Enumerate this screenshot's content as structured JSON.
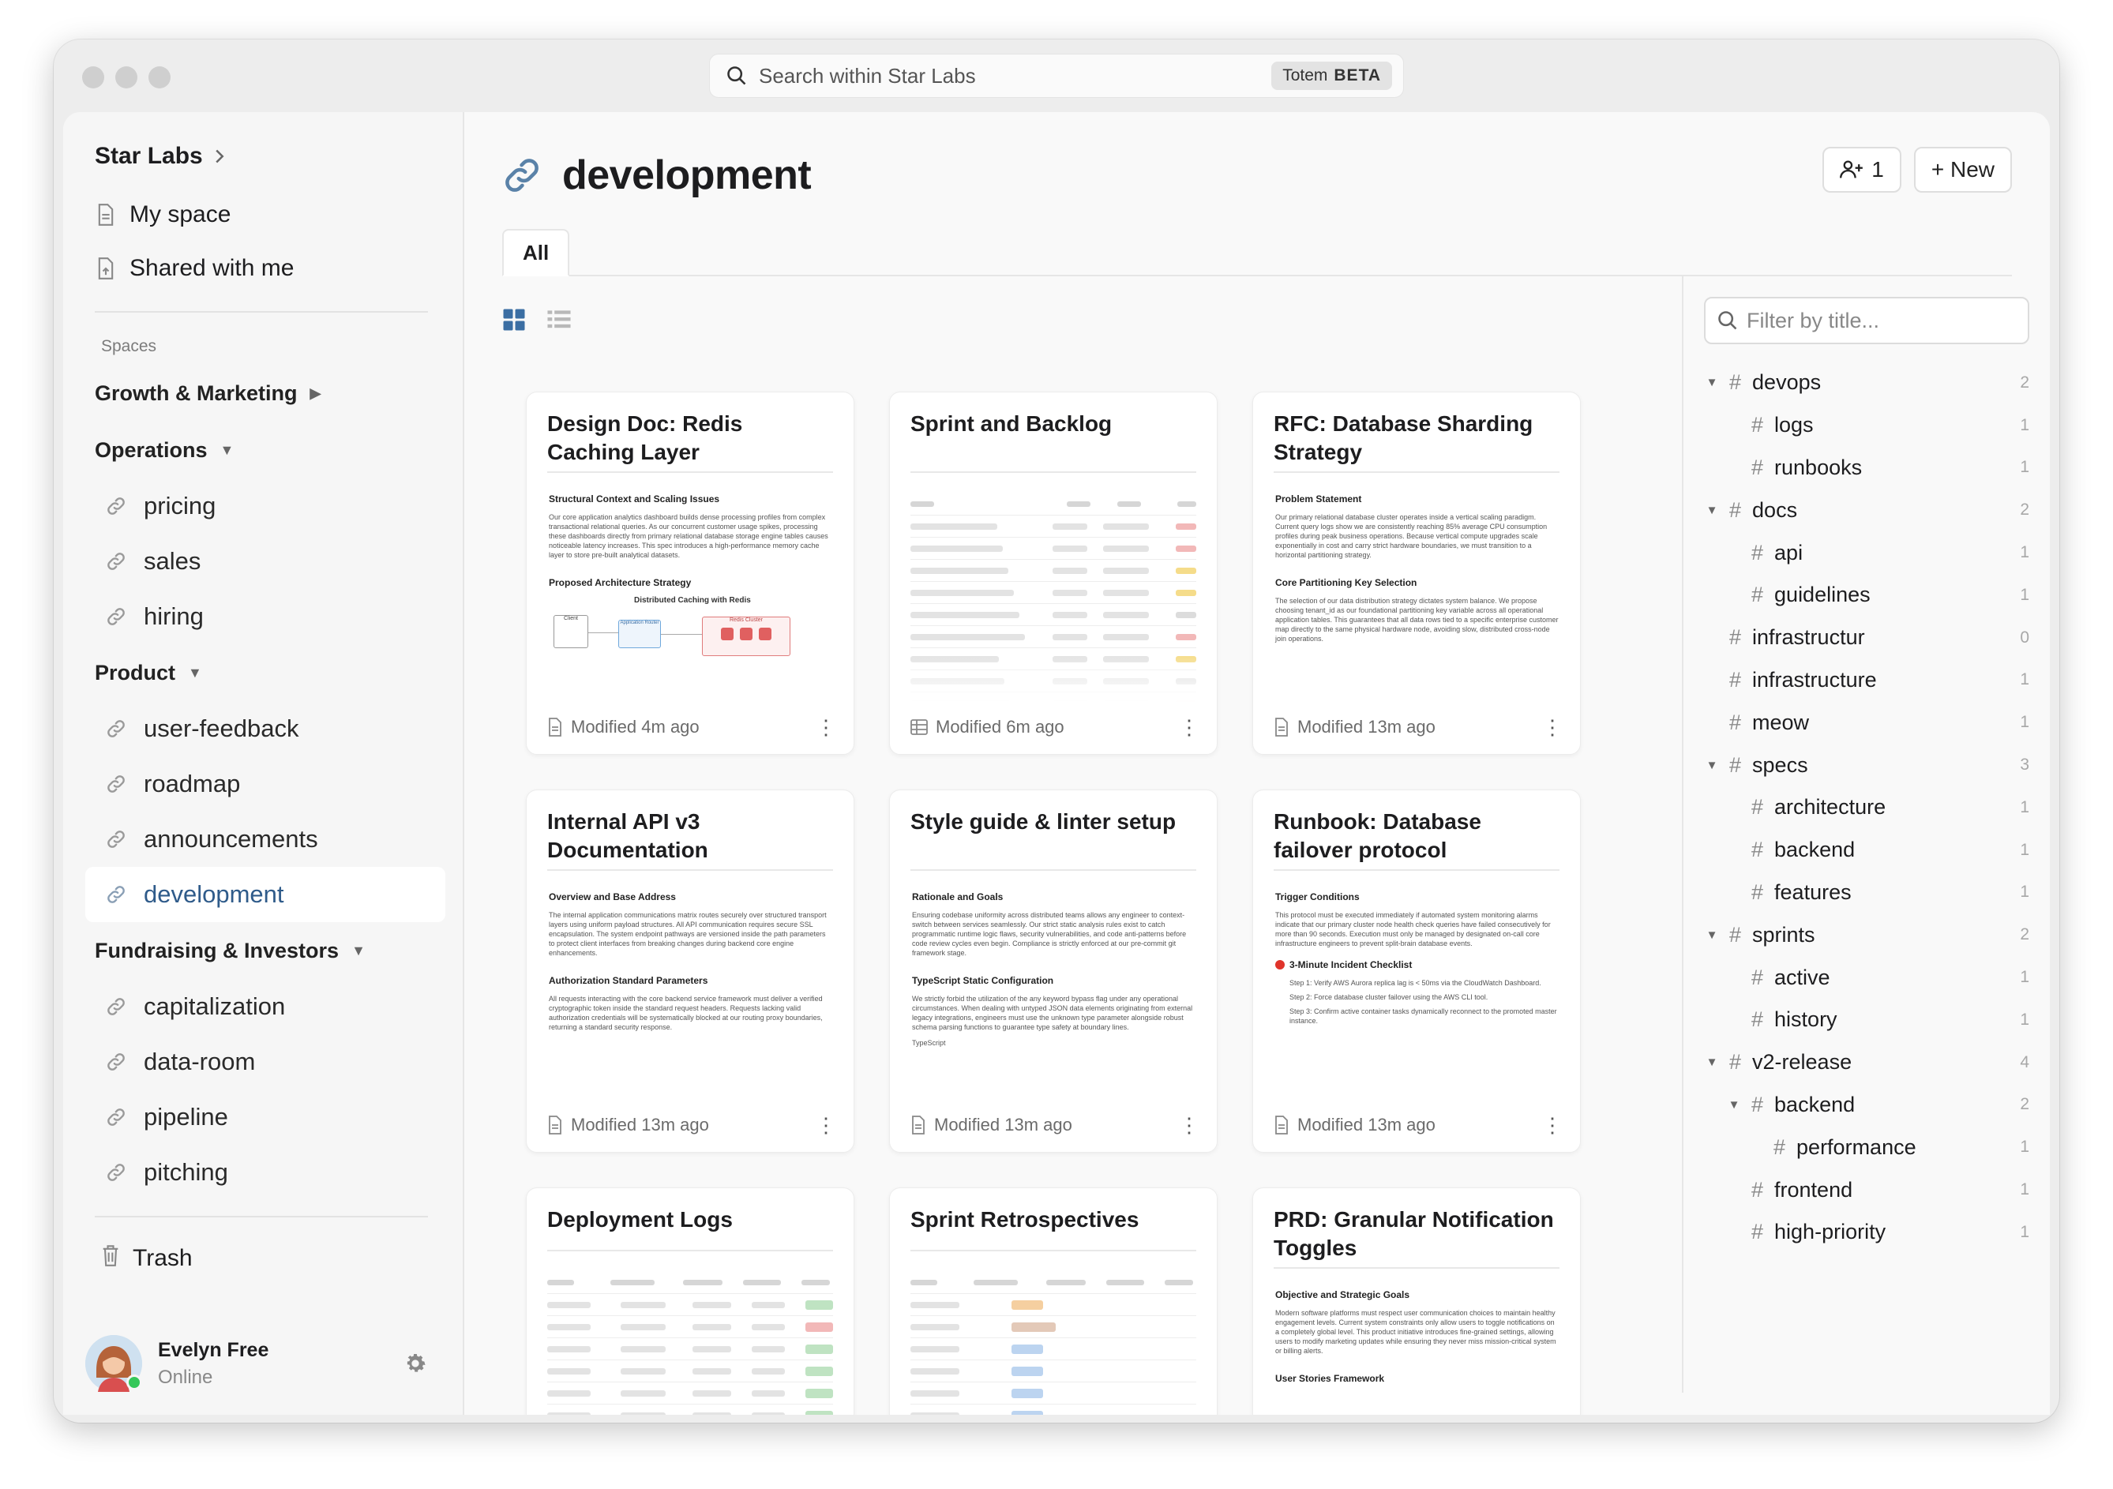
{
  "search": {
    "placeholder": "Search within Star Labs",
    "badge_name": "Totem",
    "badge_tag": "BETA"
  },
  "sidebar": {
    "workspace": "Star Labs",
    "top_items": [
      {
        "label": "My space"
      },
      {
        "label": "Shared with me"
      }
    ],
    "spaces_label": "Spaces",
    "groups": {
      "growth": {
        "label": "Growth & Marketing"
      },
      "operations": {
        "label": "Operations",
        "items": [
          "pricing",
          "sales",
          "hiring"
        ]
      },
      "product": {
        "label": "Product",
        "items": [
          "user-feedback",
          "roadmap",
          "announcements",
          "development"
        ]
      },
      "fundraising": {
        "label": "Fundraising & Investors",
        "items": [
          "capitalization",
          "data-room",
          "pipeline",
          "pitching"
        ]
      }
    },
    "trash": "Trash",
    "user": {
      "name": "Evelyn Free",
      "status": "Online"
    }
  },
  "page": {
    "title": "development",
    "members_count": "1",
    "new_label": "+ New",
    "tab_all": "All"
  },
  "cards": [
    {
      "title": "Design Doc: Redis Caching Layer",
      "modified": "Modified 4m ago",
      "h1": "Structural Context and Scaling Issues",
      "p1": "Our core application analytics dashboard builds dense processing profiles from complex transactional relational queries. As our concurrent customer usage spikes, processing these dashboards directly from primary relational database storage engine tables causes noticeable latency increases. This spec introduces a high-performance memory cache layer to store pre-built analytical datasets.",
      "h2": "Proposed Architecture Strategy",
      "diagram_title": "Distributed Caching with Redis",
      "diagram_labels": [
        "Client",
        "Application Router",
        "Redis Cluster"
      ]
    },
    {
      "title": "Sprint and Backlog",
      "modified": "Modified 6m ago"
    },
    {
      "title": "RFC: Database Sharding Strategy",
      "modified": "Modified 13m ago",
      "h1": "Problem Statement",
      "p1": "Our primary relational database cluster operates inside a vertical scaling paradigm. Current query logs show we are consistently reaching 85% average CPU consumption profiles during peak business operations. Because vertical compute upgrades scale exponentially in cost and carry strict hardware boundaries, we must transition to a horizontal partitioning strategy.",
      "h2": "Core Partitioning Key Selection",
      "p2": "The selection of our data distribution strategy dictates system balance. We propose choosing tenant_id as our foundational partitioning key variable across all operational application tables. This guarantees that all data rows tied to a specific enterprise customer map directly to the same physical hardware node, avoiding slow, distributed cross-node join operations."
    },
    {
      "title": "Internal API v3 Documentation",
      "modified": "Modified 13m ago",
      "h1": "Overview and Base Address",
      "p1": "The internal application communications matrix routes securely over structured transport layers using uniform payload structures. All API communication requires secure SSL encapsulation. The system endpoint pathways are versioned inside the path parameters to protect client interfaces from breaking changes during backend core engine enhancements.",
      "h2": "Authorization Standard Parameters",
      "p2": "All requests interacting with the core backend service framework must deliver a verified cryptographic token inside the standard request headers. Requests lacking valid authorization credentials will be systematically blocked at our routing proxy boundaries, returning a standard security response."
    },
    {
      "title": "Style guide & linter setup",
      "modified": "Modified 13m ago",
      "h1": "Rationale and Goals",
      "p1": "Ensuring codebase uniformity across distributed teams allows any engineer to context-switch between services seamlessly. Our strict static analysis rules exist to catch programmatic runtime logic flaws, security vulnerabilities, and code anti-patterns before code review cycles even begin. Compliance is strictly enforced at our pre-commit git framework stage.",
      "h2": "TypeScript Static Configuration",
      "p2": "We strictly forbid the utilization of the any keyword bypass flag under any operational circumstances. When dealing with untyped JSON data elements originating from external legacy integrations, engineers must use the unknown type parameter alongside robust schema parsing functions to guarantee type safety at boundary lines.",
      "p3": "TypeScript"
    },
    {
      "title": "Runbook: Database failover protocol",
      "modified": "Modified 13m ago",
      "h1": "Trigger Conditions",
      "p1": "This protocol must be executed immediately if automated system monitoring alarms indicate that our primary cluster node health check queries have failed consecutively for more than 90 seconds. Execution must only be managed by designated on-call core infrastructure engineers to prevent split-brain database events.",
      "h2": "3-Minute Incident Checklist",
      "steps": [
        "Step 1: Verify AWS Aurora replica lag is < 50ms via the CloudWatch Dashboard.",
        "Step 2: Force database cluster failover using the AWS CLI tool.",
        "Step 3: Confirm active container tasks dynamically reconnect to the promoted master instance."
      ]
    },
    {
      "title": "Deployment Logs",
      "modified": ""
    },
    {
      "title": "Sprint Retrospectives",
      "modified": ""
    },
    {
      "title": "PRD: Granular Notification Toggles",
      "modified": "",
      "h1": "Objective and Strategic Goals",
      "p1": "Modern software platforms must respect user communication choices to maintain healthy engagement levels. Current system constraints only allow users to toggle notifications on a completely global level. This product initiative introduces fine-grained settings, allowing users to modify marketing updates while ensuring they never miss mission-critical system or billing alerts.",
      "h2": "User Stories Framework"
    }
  ],
  "filter": {
    "placeholder": "Filter by title..."
  },
  "tags": [
    {
      "name": "devops",
      "count": "2",
      "level": 0,
      "caret": true
    },
    {
      "name": "logs",
      "count": "1",
      "level": 1,
      "caret": false
    },
    {
      "name": "runbooks",
      "count": "1",
      "level": 1,
      "caret": false
    },
    {
      "name": "docs",
      "count": "2",
      "level": 0,
      "caret": true
    },
    {
      "name": "api",
      "count": "1",
      "level": 1,
      "caret": false
    },
    {
      "name": "guidelines",
      "count": "1",
      "level": 1,
      "caret": false
    },
    {
      "name": "infrastructur",
      "count": "0",
      "level": 0,
      "caret": false
    },
    {
      "name": "infrastructure",
      "count": "1",
      "level": 0,
      "caret": false
    },
    {
      "name": "meow",
      "count": "1",
      "level": 0,
      "caret": false
    },
    {
      "name": "specs",
      "count": "3",
      "level": 0,
      "caret": true
    },
    {
      "name": "architecture",
      "count": "1",
      "level": 1,
      "caret": false
    },
    {
      "name": "backend",
      "count": "1",
      "level": 1,
      "caret": false
    },
    {
      "name": "features",
      "count": "1",
      "level": 1,
      "caret": false
    },
    {
      "name": "sprints",
      "count": "2",
      "level": 0,
      "caret": true
    },
    {
      "name": "active",
      "count": "1",
      "level": 1,
      "caret": false
    },
    {
      "name": "history",
      "count": "1",
      "level": 1,
      "caret": false
    },
    {
      "name": "v2-release",
      "count": "4",
      "level": 0,
      "caret": true
    },
    {
      "name": "backend",
      "count": "2",
      "level": 1,
      "caret": true
    },
    {
      "name": "performance",
      "count": "1",
      "level": 2,
      "caret": false
    },
    {
      "name": "frontend",
      "count": "1",
      "level": 1,
      "caret": false
    },
    {
      "name": "high-priority",
      "count": "1",
      "level": 1,
      "caret": false
    }
  ],
  "colors": {
    "accent": "#2f5b8a",
    "online": "#34c759",
    "sidebar_bg": "#f6f6f6"
  },
  "icons": [
    "search-icon",
    "chevron-right-icon",
    "document-icon",
    "shared-document-icon",
    "link-icon",
    "trash-icon",
    "gear-icon",
    "add-person-icon",
    "grid-view-icon",
    "list-view-icon",
    "table-icon",
    "more-icon",
    "hash-icon"
  ]
}
